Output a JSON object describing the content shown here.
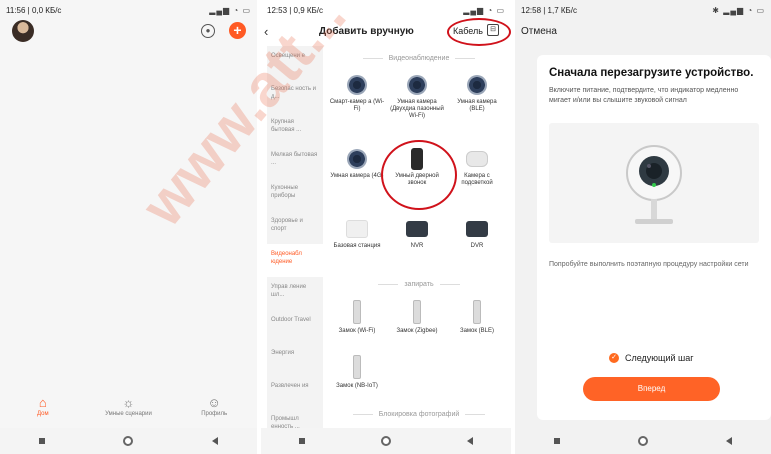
{
  "phone1": {
    "status_time": "11:56 | 0,0 КБ/с",
    "tabs": [
      {
        "label": "Дом",
        "icon": "home-icon"
      },
      {
        "label": "Умные сценарии",
        "icon": "sun-icon"
      },
      {
        "label": "Профиль",
        "icon": "profile-icon"
      }
    ]
  },
  "phone2": {
    "status_time": "12:53 | 0,9 КБ/с",
    "title": "Добавить вручную",
    "cable_label": "Кабель",
    "categories": [
      "Освещени е",
      "Безопас ность и д...",
      "Крупная бытовая ...",
      "Мелкая бытовая ...",
      "Кухонные приборы",
      "Здоровье и спорт",
      "Видеонабл юдение",
      "Управ ление шл...",
      "Outdoor Travel",
      "Энергия",
      "Развлечен ия",
      "Промышл енность ..."
    ],
    "sections": {
      "video": "Видеонаблюдение",
      "lock": "запирать",
      "photo": "Блокировка фотографий"
    },
    "video_devices": [
      "Смарт-камер а (Wi-Fi)",
      "Умная камера (Двухдиа пазонный Wi-Fi)",
      "Умная камера (BLE)",
      "Умная камера (4G)",
      "Умный дверной звонок",
      "Камера с подсветкой",
      "Базовая станция",
      "NVR",
      "DVR"
    ],
    "lock_devices": [
      "Замок (Wi-Fi)",
      "Замок (Zigbee)",
      "Замок (BLE)",
      "Замок (NB-IoT)"
    ]
  },
  "phone3": {
    "status_time": "12:58 | 1,7 КБ/с",
    "cancel": "Отмена",
    "heading": "Сначала перезагрузите устройство.",
    "instruction": "Включите питание, подтвердите, что индикатор медленно мигает и/или вы слышите звуковой сигнал",
    "hint": "Попробуйте выполнить поэтапную процедуру настройки сети",
    "next_step": "Следующий шаг",
    "forward": "Вперед"
  },
  "watermark": "www.att..."
}
